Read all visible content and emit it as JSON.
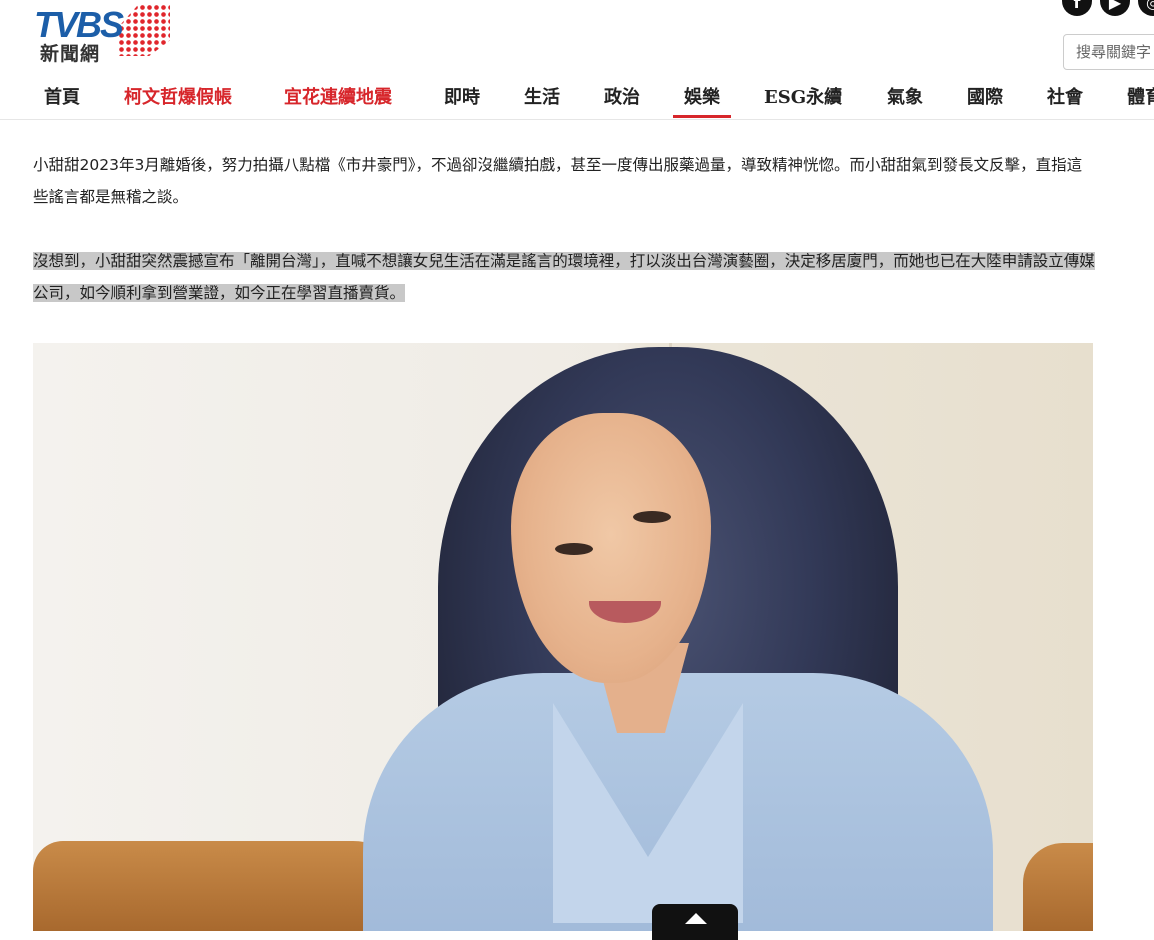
{
  "logo": {
    "main": "TVBS",
    "sub": "新聞網"
  },
  "social": [
    "f",
    "▶",
    "◎"
  ],
  "search": {
    "placeholder": "搜尋關鍵字"
  },
  "nav": [
    {
      "label": "首頁",
      "style": "normal"
    },
    {
      "label": "柯文哲爆假帳",
      "style": "hot"
    },
    {
      "label": "宜花連續地震",
      "style": "hot"
    },
    {
      "label": "即時",
      "style": "normal"
    },
    {
      "label": "生活",
      "style": "normal"
    },
    {
      "label": "政治",
      "style": "normal"
    },
    {
      "label": "娛樂",
      "style": "active"
    },
    {
      "label": "ESG永續",
      "style": "normal"
    },
    {
      "label": "氣象",
      "style": "normal"
    },
    {
      "label": "國際",
      "style": "normal"
    },
    {
      "label": "社會",
      "style": "normal"
    },
    {
      "label": "體育",
      "style": "normal"
    }
  ],
  "article": {
    "paragraph1": "小甜甜2023年3月離婚後，努力拍攝八點檔《市井豪門》，不過卻沒繼續拍戲，甚至一度傳出服藥過量，導致精神恍惚。而小甜甜氣到發長文反擊，直指這些謠言都是無稽之談。",
    "paragraph2": "沒想到，小甜甜突然震撼宣布「離開台灣」，直喊不想讓女兒生活在滿是謠言的環境裡，打以淡出台灣演藝圈，決定移居廈門，而她也已在大陸申請設立傳媒公司，如今順利拿到營業證，如今正在學習直播賣貨。"
  },
  "colors": {
    "accent": "#d7262b",
    "brand_blue": "#1c5ea8"
  }
}
